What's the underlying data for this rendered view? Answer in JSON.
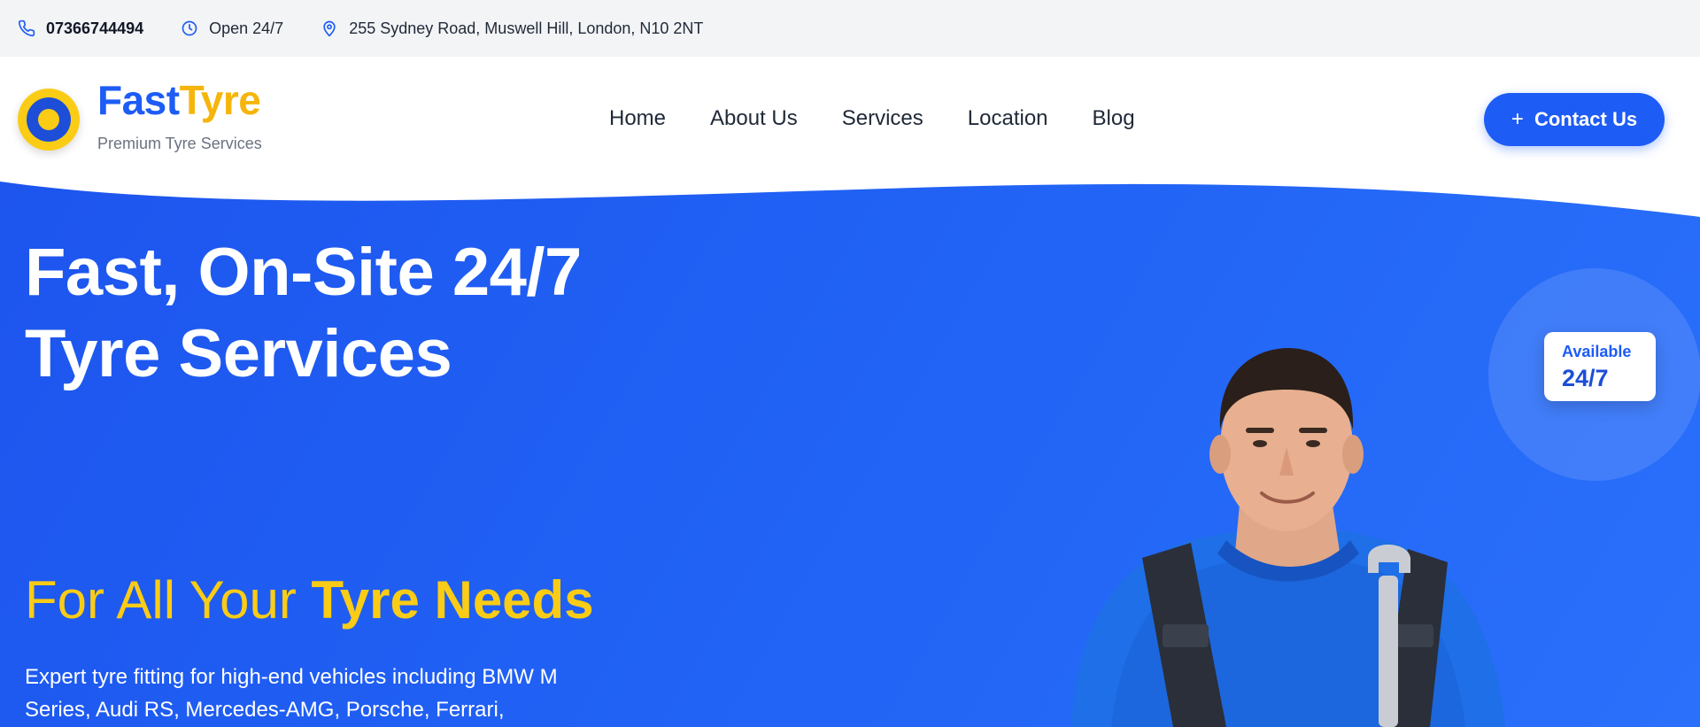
{
  "topbar": {
    "phone": "07366744494",
    "hours": "Open 24/7",
    "address": "255 Sydney Road, Muswell Hill, London, N10 2NT",
    "icons": [
      "phone-icon",
      "clock-icon",
      "map-pin-icon"
    ]
  },
  "header": {
    "brand_part1": "Fast",
    "brand_part2": "Tyre",
    "tagline": "Premium Tyre Services",
    "nav": [
      "Home",
      "About Us",
      "Services",
      "Location",
      "Blog"
    ],
    "contact_label": "Contact Us"
  },
  "hero": {
    "title_line1": "Fast, On-Site 24/7",
    "title_line2": "Tyre Services",
    "subtitle_prefix": "For All Your ",
    "subtitle_bold": "Tyre Needs",
    "description": "Expert tyre fitting for high-end vehicles including BMW M Series, Audi RS, Mercedes-AMG, Porsche, Ferrari,",
    "badge_label": "Available",
    "badge_value": "24/7"
  },
  "colors": {
    "primary_blue": "#1d5cf5",
    "accent_yellow": "#facc15",
    "brand_orange": "#f5b50a",
    "topbar_bg": "#f3f4f6"
  }
}
